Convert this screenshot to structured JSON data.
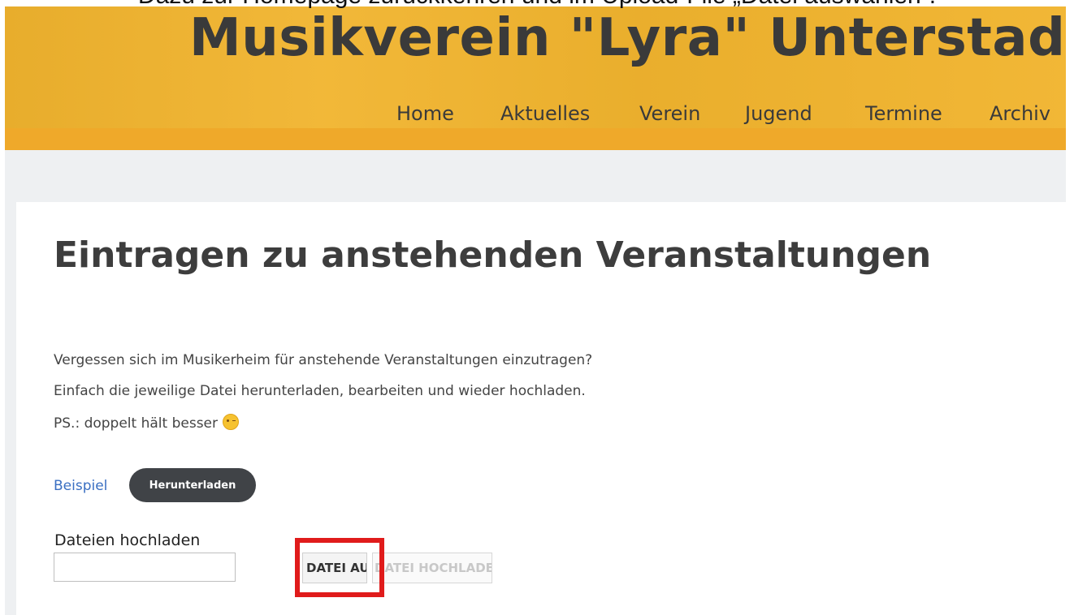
{
  "caption": "Dazu zur Homepage zurückkehren und im Upload-File „Datei auswählen“.",
  "site": {
    "title": "Musikverein \"Lyra\" Unterstadi",
    "nav": [
      "Home",
      "Aktuelles",
      "Verein",
      "Jugend",
      "Termine",
      "Archiv"
    ]
  },
  "page": {
    "title": "Eintragen zu anstehenden Veranstaltungen",
    "lines": [
      "Vergessen sich im Musikerheim für anstehende Veranstaltungen einzutragen?",
      "Einfach die jeweilige Datei herunterladen, bearbeiten und wieder hochladen.",
      "PS.: doppelt hält besser"
    ],
    "example_link": "Beispiel",
    "download_button": "Herunterladen",
    "upload_label": "Dateien hochladen",
    "choose_button": "DATEI AUSWÄHLEN",
    "upload_button": "DATEI HOCHLADEN"
  },
  "colors": {
    "header": "#f1b42e",
    "highlight": "#e01b1b",
    "link": "#3a6fc2",
    "dark_button": "#404347"
  },
  "icons": {
    "emoji": "winking-face-icon"
  }
}
